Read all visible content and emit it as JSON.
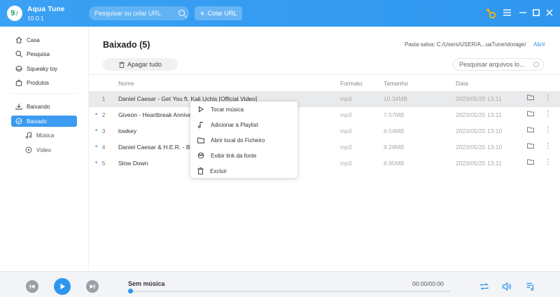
{
  "app": {
    "name": "Aqua Tune",
    "version": "10.0.1",
    "logo_text": "9♪"
  },
  "topbar": {
    "search_placeholder": "Pesquisar ou colar URL",
    "paste_label": "Colar URL",
    "icons": [
      "search-icon",
      "plus-icon",
      "key-icon",
      "menu-icon",
      "minimize-icon",
      "maximize-icon",
      "close-icon"
    ],
    "key_color": "#f5b800"
  },
  "sidebar": {
    "items": [
      {
        "label": "Casa",
        "icon": "home-icon"
      },
      {
        "label": "Pesquisa",
        "icon": "search-icon"
      },
      {
        "label": "Squeaky toy",
        "icon": "squeaky-toy-icon"
      },
      {
        "label": "Produtos",
        "icon": "bag-icon"
      },
      {
        "label": "Baixando",
        "icon": "download-icon"
      },
      {
        "label": "Baixado",
        "icon": "check-circle-icon",
        "active": true
      },
      {
        "label": "Música",
        "icon": "music-note-icon"
      },
      {
        "label": "Vídeo",
        "icon": "play-circle-icon"
      }
    ],
    "active_color": "#3a9bf0"
  },
  "main": {
    "title": "Baixado (5)",
    "save_path": "Pasta salva: C:/Users/USER/A...uaTune/storage/",
    "open_label": "Abrir",
    "delete_all_label": "Apagar tudo",
    "search_placeholder": "Pesquisar arquivos lo...",
    "columns": {
      "name": "Nome",
      "format": "Formato",
      "size": "Tamanho",
      "date": "Data"
    },
    "rows": [
      {
        "num": "1",
        "dot": "",
        "name": "Daniel Caesar - Get You ft. Kali Uchis [Official Video]",
        "format": "mp3",
        "size": "10.34MB",
        "date": "2023/05/25 13:11"
      },
      {
        "num": "2",
        "dot": "•",
        "name": "Giveon - Heartbreak Anniversary",
        "format": "mp3",
        "size": "7.57MB",
        "date": "2023/05/25 13:11"
      },
      {
        "num": "3",
        "dot": "•",
        "name": "lowkey",
        "format": "mp3",
        "size": "6.54MB",
        "date": "2023/05/25 13:10"
      },
      {
        "num": "4",
        "dot": "•",
        "name": "Daniel Caesar & H.E.R. - Best Part",
        "format": "mp3",
        "size": "9.28MB",
        "date": "2023/05/25 13:10"
      },
      {
        "num": "5",
        "dot": "•",
        "name": "Slow Down",
        "format": "mp3",
        "size": "8.95MB",
        "date": "2023/05/25 13:11"
      }
    ]
  },
  "context_menu": {
    "items": [
      {
        "label": "Tocar música",
        "icon": "play-icon"
      },
      {
        "label": "Adicionar à Playlist",
        "icon": "playlist-add-icon"
      },
      {
        "label": "Abrir local do Ficheiro",
        "icon": "folder-icon"
      },
      {
        "label": "Exibir link da fonte",
        "icon": "link-icon"
      },
      {
        "label": "Excluir",
        "icon": "trash-icon"
      }
    ]
  },
  "player": {
    "now_playing": "Sem música",
    "time": "00:00/00:00",
    "progress": 0,
    "accent": "#2f96ee"
  }
}
